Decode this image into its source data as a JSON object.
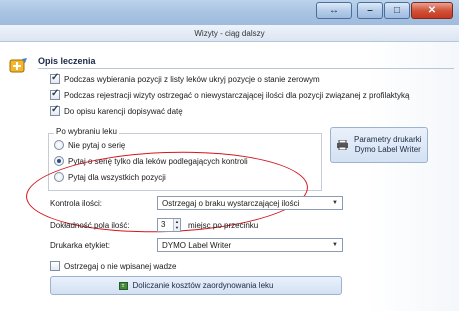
{
  "window": {
    "title": "Wizyty - ciąg dalszy",
    "buttons": {
      "minimize": "–",
      "maximize": "□",
      "close": "✕"
    }
  },
  "section": {
    "title": "Opis leczenia"
  },
  "options": {
    "hide_zero_stock": {
      "label": "Podczas wybierania pozycji z listy leków ukryj pozycje o stanie zerowym",
      "checked": true
    },
    "warn_prophylaxis": {
      "label": "Podczas rejestracji wizyty ostrzegać o niewystarczającej ilości dla pozycji związanej z profilaktyką",
      "checked": true
    },
    "add_waiting_date": {
      "label": "Do opisu karencji dopisywać datę",
      "checked": true
    }
  },
  "series_group": {
    "label": "Po wybraniu leku",
    "options": [
      {
        "label": "Nie pytaj o serię",
        "selected": false
      },
      {
        "label": "Pytaj o serię tylko dla leków podlegających kontroli",
        "selected": true
      },
      {
        "label": "Pytaj dla wszystkich pozycji",
        "selected": false
      }
    ]
  },
  "printer_button": {
    "line1": "Parametry drukarki",
    "line2": "Dymo Label Writer"
  },
  "quantity_control": {
    "label": "Kontrola ilości:",
    "value": "Ostrzegaj o braku wystarczającej ilości"
  },
  "precision": {
    "label": "Dokładność pola ilość:",
    "value": "3",
    "suffix": "miejsc po przecinku"
  },
  "label_printer": {
    "label": "Drukarka etykiet:",
    "value": "DYMO Label Writer"
  },
  "warn_weight": {
    "label": "Ostrzegaj o nie wpisanej wadze",
    "checked": false
  },
  "calc_button": {
    "label": "Doliczanie kosztów zaordynowania leku"
  },
  "colors": {
    "annotation": "#d3161f",
    "accent": "#9fbcdd"
  }
}
